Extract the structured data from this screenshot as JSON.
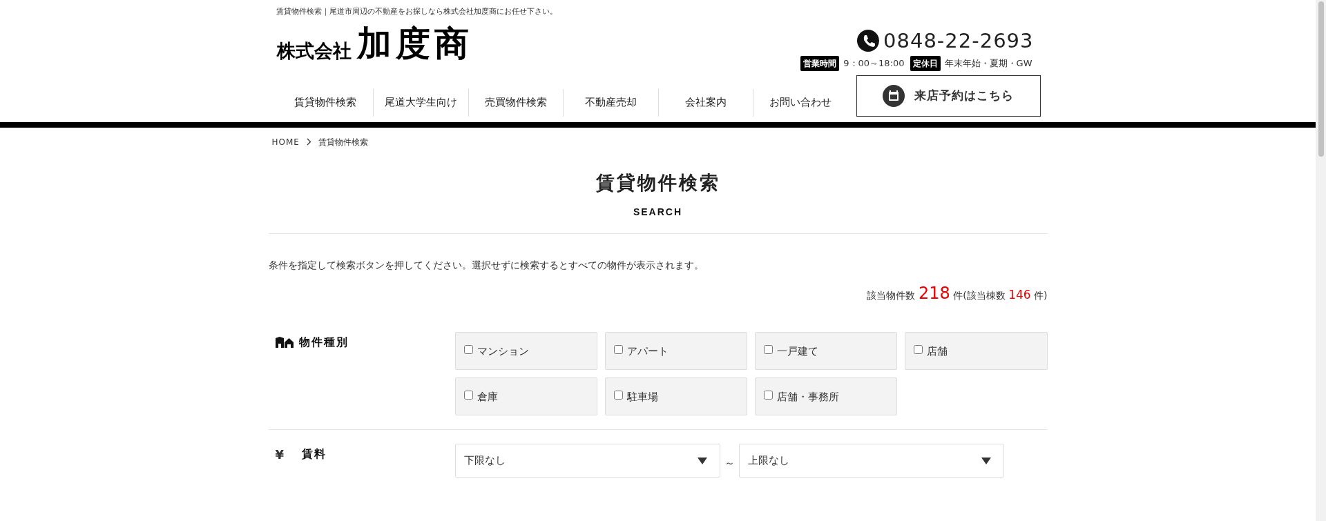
{
  "header": {
    "tagline": "賃貸物件検索｜尾道市周辺の不動産をお探しなら株式会社加度商にお任せ下さい。",
    "logo_small": "株式会社",
    "logo_large": "加度商",
    "phone": "0848-22-2693",
    "hours": [
      {
        "badge": "営業時間",
        "text": "9：00～18:00"
      },
      {
        "badge": "定休日",
        "text": "年末年始・夏期・GW"
      }
    ]
  },
  "nav": {
    "items": [
      {
        "label": "賃貸物件検索"
      },
      {
        "label": "尾道大学生向け"
      },
      {
        "label": "売買物件検索"
      },
      {
        "label": "不動産売却"
      },
      {
        "label": "会社案内"
      },
      {
        "label": "お問い合わせ"
      }
    ],
    "reserve_button": "来店予約はこちら"
  },
  "breadcrumb": [
    "HOME",
    "賃貸物件検索"
  ],
  "page_title": "賃貸物件検索",
  "page_subtitle": "SEARCH",
  "instruction": "条件を指定して検索ボタンを押してください。選択せずに検索するとすべての物件が表示されます。",
  "count": {
    "prefix": "該当物件数",
    "properties": "218",
    "middle": "件(該当棟数",
    "buildings": "146",
    "suffix": "件)"
  },
  "sections": [
    {
      "kind": "checkboxes",
      "label": "物件種別",
      "options": [
        {
          "label": "マンション",
          "checked": false
        },
        {
          "label": "アパート",
          "checked": false
        },
        {
          "label": "一戸建て",
          "checked": false
        },
        {
          "label": "店舗",
          "checked": false
        },
        {
          "label": "倉庫",
          "checked": false
        },
        {
          "label": "駐車場",
          "checked": false
        },
        {
          "label": "店舗・事務所",
          "checked": false
        }
      ]
    },
    {
      "kind": "range",
      "icon_text": "¥",
      "label": "賃料",
      "min": "下限なし",
      "separator": "～",
      "max": "上限なし"
    }
  ]
}
